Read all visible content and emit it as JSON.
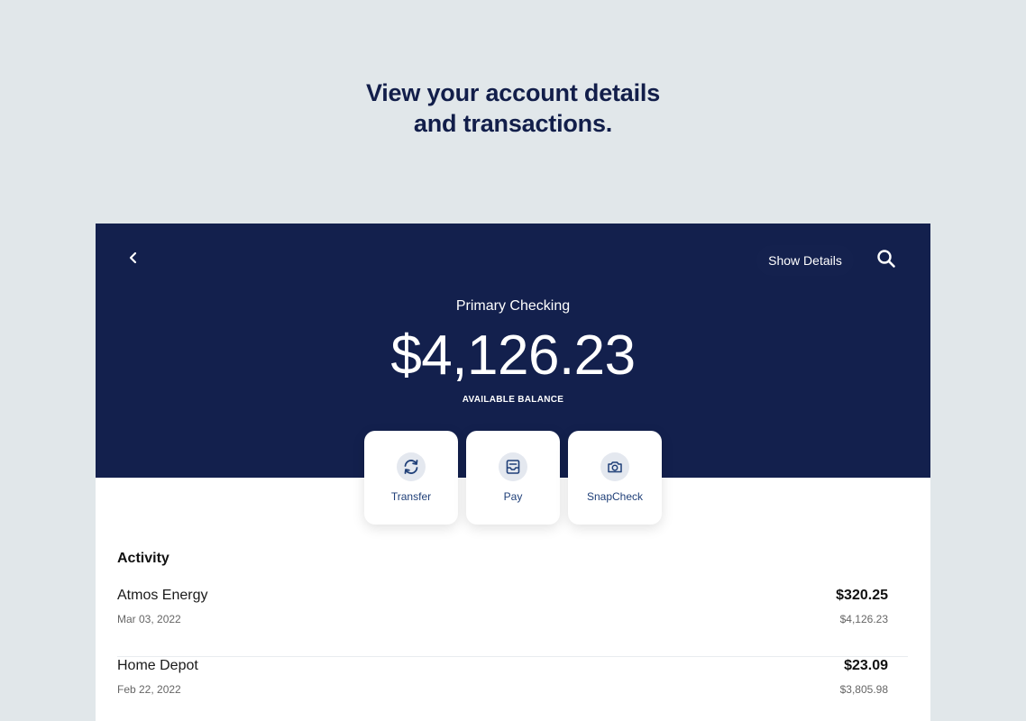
{
  "headline": {
    "line1": "View your account details",
    "line2": "and transactions."
  },
  "header": {
    "show_details_label": "Show Details"
  },
  "account": {
    "name": "Primary Checking",
    "balance": "$4,126.23",
    "balance_label": "AVAILABLE BALANCE"
  },
  "actions": [
    {
      "label": "Transfer",
      "icon": "transfer-icon"
    },
    {
      "label": "Pay",
      "icon": "pay-icon"
    },
    {
      "label": "SnapCheck",
      "icon": "camera-icon"
    }
  ],
  "activity": {
    "title": "Activity",
    "transactions": [
      {
        "name": "Atmos Energy",
        "date": "Mar 03, 2022",
        "amount": "$320.25",
        "running_balance": "$4,126.23"
      },
      {
        "name": "Home Depot",
        "date": "Feb 22, 2022",
        "amount": "$23.09",
        "running_balance": "$3,805.98"
      }
    ]
  },
  "colors": {
    "page_background": "#e1e7ea",
    "headline": "#121e4a",
    "hero_background": "#13204d",
    "action_text": "#1f3f78",
    "icon_circle": "#e4e8ef"
  }
}
